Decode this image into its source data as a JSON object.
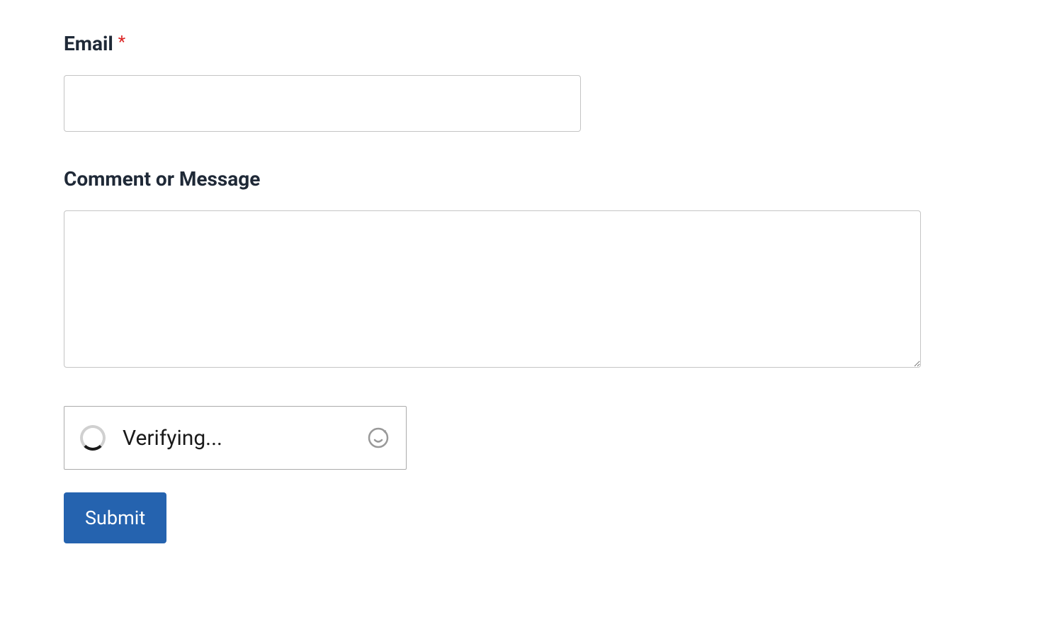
{
  "form": {
    "email": {
      "label": "Email",
      "required_mark": "*",
      "value": ""
    },
    "message": {
      "label": "Comment or Message",
      "value": ""
    },
    "captcha": {
      "status_text": "Verifying..."
    },
    "submit": {
      "label": "Submit"
    }
  }
}
